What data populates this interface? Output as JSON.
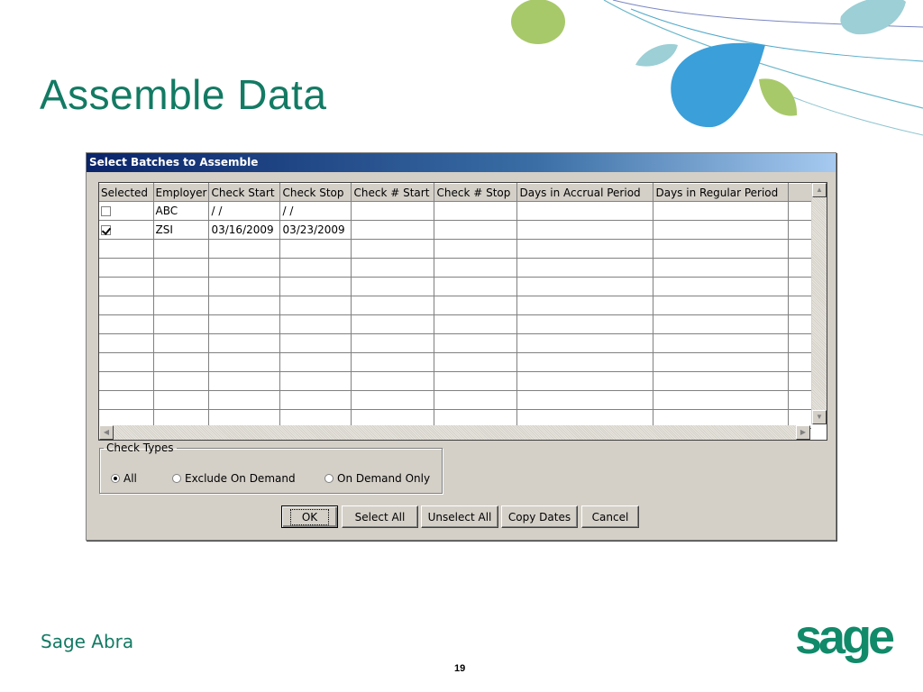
{
  "slide": {
    "title": "Assemble Data",
    "brand": "Sage Abra",
    "logo_text": "sage",
    "page_number": "19"
  },
  "colors": {
    "title_green": "#137a63",
    "logo_green": "#118a6a",
    "leaf_green": "#a8c96a",
    "drop_blue": "#3b9fd9",
    "leaf_teal": "#9ccfd6"
  },
  "dialog": {
    "title": "Select Batches to Assemble",
    "columns": [
      "Selected",
      "Employer",
      "Check Start",
      "Check Stop",
      "Check # Start",
      "Check # Stop",
      "Days in Accrual Period",
      "Days in Regular Period"
    ],
    "rows": [
      {
        "selected": false,
        "employer": "ABC",
        "check_start": "/ /",
        "check_stop": "/ /",
        "check_num_start": "",
        "check_num_stop": "",
        "accrual_days": "",
        "regular_days": ""
      },
      {
        "selected": true,
        "employer": "ZSI",
        "check_start": "03/16/2009",
        "check_stop": "03/23/2009",
        "check_num_start": "",
        "check_num_stop": "",
        "accrual_days": "",
        "regular_days": ""
      }
    ],
    "check_types": {
      "legend": "Check Types",
      "options": [
        "All",
        "Exclude On Demand",
        "On Demand Only"
      ],
      "selected": "All"
    },
    "buttons": {
      "ok": "OK",
      "select_all": "Select All",
      "unselect_all": "Unselect All",
      "copy_dates": "Copy Dates",
      "cancel": "Cancel"
    }
  }
}
